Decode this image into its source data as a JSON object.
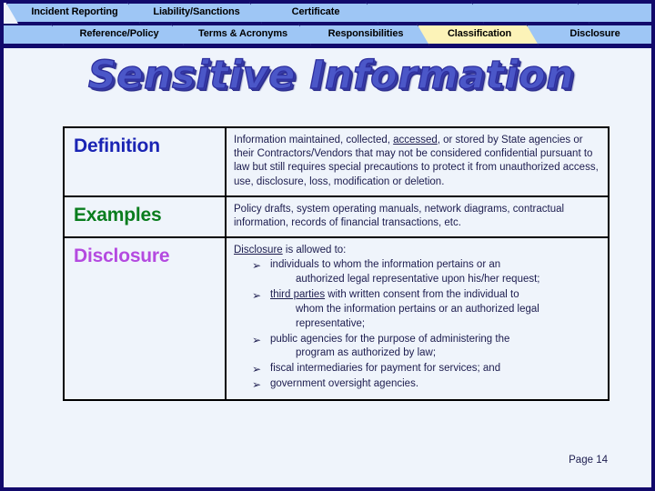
{
  "slide": {
    "title": "Sensitive Information",
    "page_label": "Page 14",
    "background_color": "#eff4fb",
    "border_color": "#120a6b"
  },
  "tabs": {
    "active_tab": "Classification",
    "tab_fill_color": "#9ec6f5",
    "active_tab_fill_color": "#fcf3b8",
    "row_top": [
      {
        "label": "Incident Reporting",
        "active": false
      },
      {
        "label": "Liability/Sanctions",
        "active": false
      },
      {
        "label": "Certificate",
        "active": false
      },
      {
        "label": "",
        "active": false
      },
      {
        "label": "",
        "active": false
      },
      {
        "label": "",
        "active": false
      }
    ],
    "row_bottom": [
      {
        "label": "Reference/Policy",
        "active": false
      },
      {
        "label": "Terms & Acronyms",
        "active": false
      },
      {
        "label": "Responsibilities",
        "active": false
      },
      {
        "label": "Classification",
        "active": true
      },
      {
        "label": "Disclosure",
        "active": false
      }
    ]
  },
  "table": {
    "rows": [
      {
        "label": "Definition",
        "label_color": "#1a24b4",
        "body_paragraph": "Information maintained, collected, accessed, or stored by State agencies or their Contractors/Vendors that may not be considered confidential pursuant to law but still  requires special precautions to protect it from unauthorized access, use, disclosure, loss, modification or deletion.",
        "body_pre": "Information maintained, collected, ",
        "body_underlined": "accessed",
        "body_post": ", or stored by State agencies or their Contractors/Vendors that may not be considered confidential pursuant to law but still  requires special precautions to protect it from unauthorized access, use, disclosure, loss, modification or deletion."
      },
      {
        "label": "Examples",
        "label_color": "#0a7d1e",
        "body_paragraph": "Policy drafts, system operating manuals, network diagrams, contractual information, records of financial transactions, etc."
      },
      {
        "label": "Disclosure",
        "label_color": "#b44ae0",
        "intro_underlined": "Disclosure",
        "intro_rest": " is allowed to:",
        "bullet_marker": "➢",
        "bullets": [
          {
            "text": "individuals to whom the information pertains or an",
            "continuation": "authorized legal representative upon his/her request;",
            "underlined": ""
          },
          {
            "underlined": "third parties",
            "text": " with written consent from the individual to",
            "continuation": "whom the information pertains or an authorized legal representative;"
          },
          {
            "text": "public agencies for the purpose of administering the",
            "continuation": "program as authorized by law;",
            "underlined": ""
          },
          {
            "text": "fiscal intermediaries for payment for services; and",
            "continuation": "",
            "underlined": ""
          },
          {
            "text": "government oversight agencies.",
            "continuation": "",
            "underlined": ""
          }
        ]
      }
    ]
  }
}
